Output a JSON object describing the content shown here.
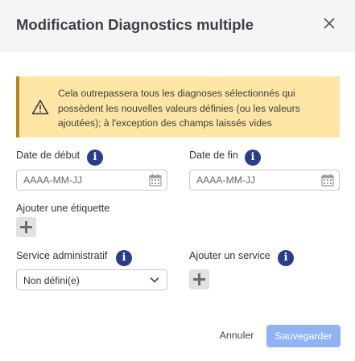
{
  "modal": {
    "title": "Modification Diagnostics multiple"
  },
  "warning": {
    "text": "Cela outrepassera tous les diagnoses sélectionnés qui possèdent les nouvelles valeurs définies (ou les valeurs ajoutées); à l'exception des champs laissés vides",
    "icon": "warning-triangle-icon"
  },
  "fields": {
    "start_date": {
      "label": "Date de début",
      "placeholder": "AAAA-MM-JJ"
    },
    "end_date": {
      "label": "Date de fin",
      "placeholder": "AAAA-MM-JJ"
    },
    "tag": {
      "label": "Ajouter une étiquette"
    },
    "admin_service": {
      "label": "Service administratif",
      "value": "Non défini(e)"
    },
    "add_service": {
      "label": "Ajouter un service"
    },
    "info_glyph": "i"
  },
  "footer": {
    "cancel_label": "Annuler",
    "save_label": "Sauvegarder"
  },
  "colors": {
    "info_badge": "#283d8c",
    "warning_bg": "#fde6a5",
    "warning_border": "#b98a14",
    "primary_button": "#8fb3f5"
  }
}
